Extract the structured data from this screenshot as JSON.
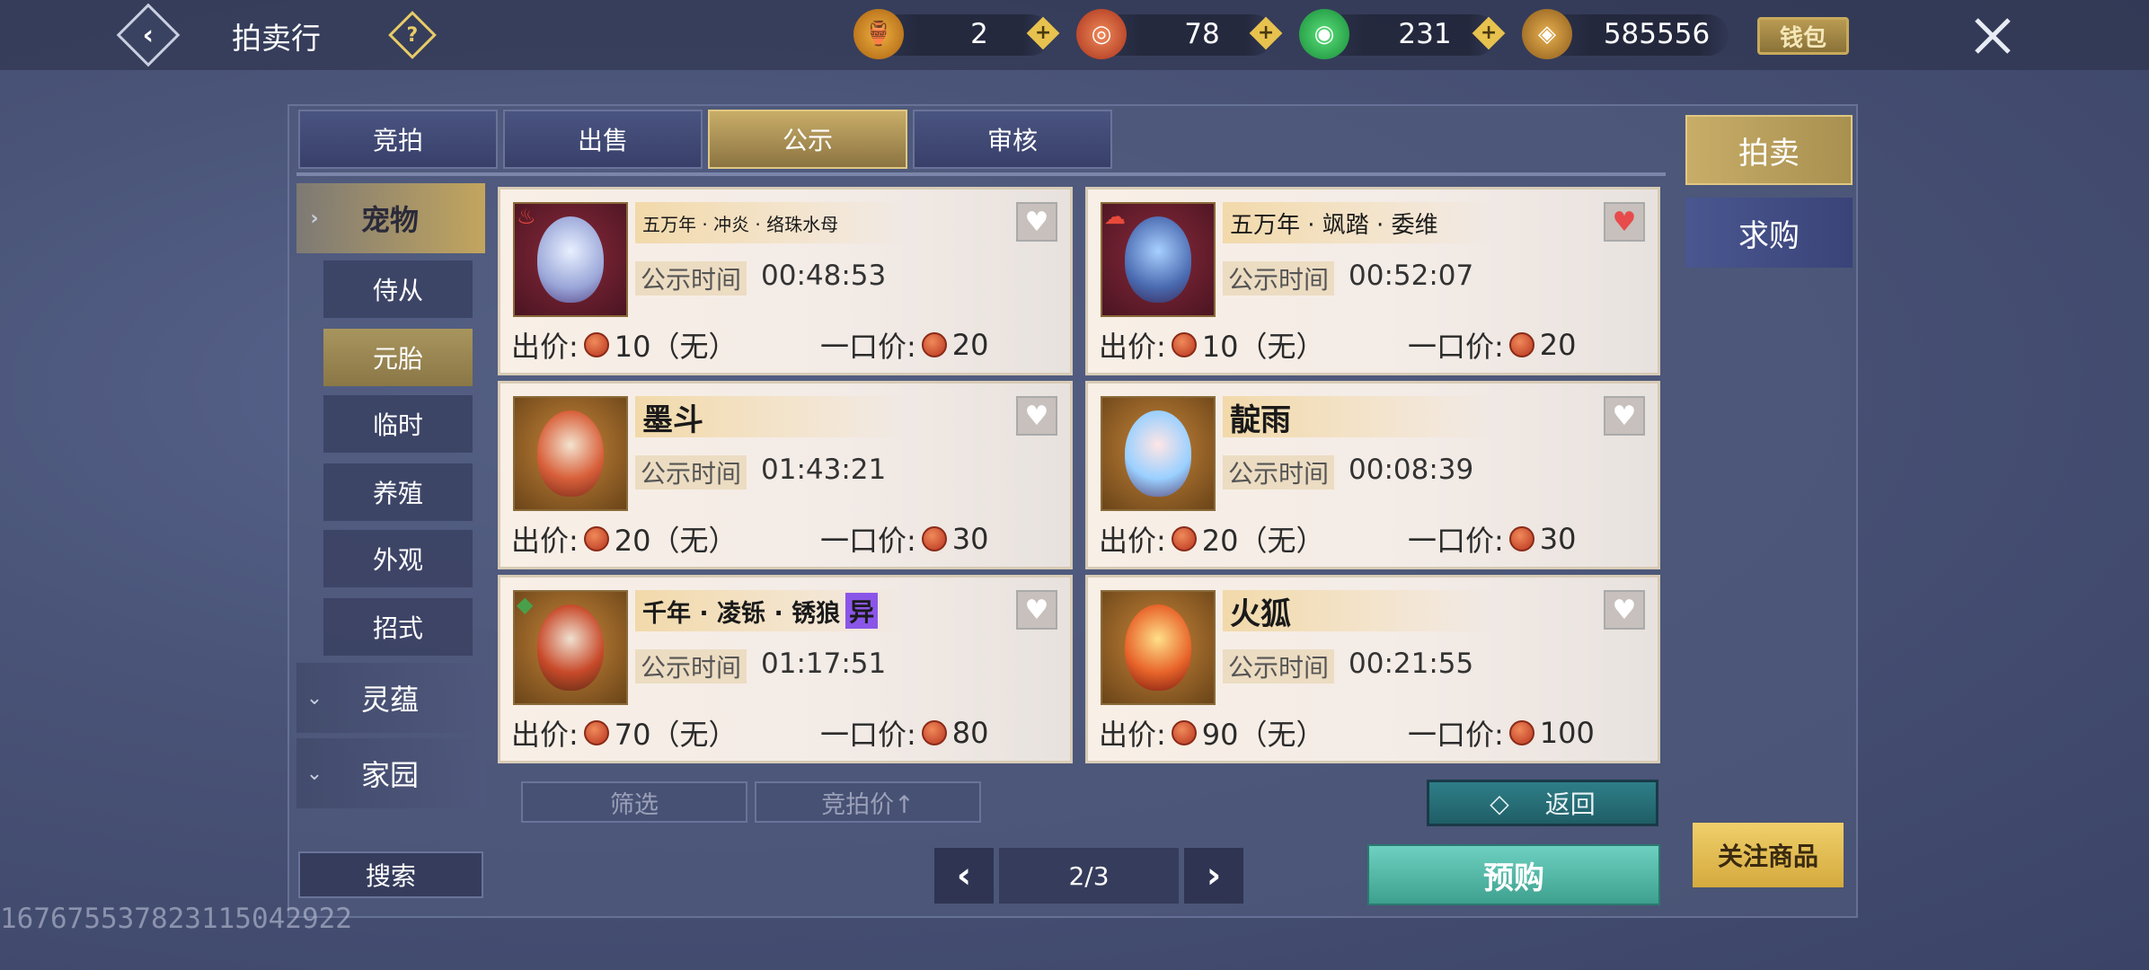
{
  "header": {
    "title": "拍卖行",
    "help_icon": "question-icon",
    "currencies": [
      {
        "name": "gold-gourd-icon",
        "value": "2"
      },
      {
        "name": "red-swirl-coin-icon",
        "value": "78"
      },
      {
        "name": "green-jade-icon",
        "value": "231"
      },
      {
        "name": "copper-coin-icon",
        "value": "585556"
      }
    ],
    "wallet_label": "钱包"
  },
  "tabs": [
    {
      "label": "竞拍",
      "active": false
    },
    {
      "label": "出售",
      "active": false
    },
    {
      "label": "公示",
      "active": true
    },
    {
      "label": "审核",
      "active": false
    }
  ],
  "sidebar": {
    "categories": [
      {
        "label": "宠物",
        "expanded": true
      },
      {
        "label": "灵蕴",
        "expanded": false
      },
      {
        "label": "家园",
        "expanded": false
      }
    ],
    "subitems": [
      {
        "label": "侍从"
      },
      {
        "label": "元胎",
        "active": true
      },
      {
        "label": "临时"
      },
      {
        "label": "养殖"
      },
      {
        "label": "外观"
      },
      {
        "label": "招式"
      }
    ]
  },
  "listings": [
    {
      "name": "五万年 · 冲炎 · 络珠水母",
      "time_label": "公示时间",
      "time": "00:48:53",
      "bid_label": "出价:",
      "bid": "10（无）",
      "buyout_label": "一口价:",
      "buyout": "20",
      "favorited": false
    },
    {
      "name": "五万年 · 飒踏 · 委维",
      "time_label": "公示时间",
      "time": "00:52:07",
      "bid_label": "出价:",
      "bid": "10（无）",
      "buyout_label": "一口价:",
      "buyout": "20",
      "favorited": true
    },
    {
      "name": "墨斗",
      "time_label": "公示时间",
      "time": "01:43:21",
      "bid_label": "出价:",
      "bid": "20（无）",
      "buyout_label": "一口价:",
      "buyout": "30",
      "favorited": false
    },
    {
      "name": "靛雨",
      "time_label": "公示时间",
      "time": "00:08:39",
      "bid_label": "出价:",
      "bid": "20（无）",
      "buyout_label": "一口价:",
      "buyout": "30",
      "favorited": false
    },
    {
      "name": "千年 · 凌铄 · 锈狼",
      "tag": "异",
      "time_label": "公示时间",
      "time": "01:17:51",
      "bid_label": "出价:",
      "bid": "70（无）",
      "buyout_label": "一口价:",
      "buyout": "80",
      "favorited": false
    },
    {
      "name": "火狐",
      "time_label": "公示时间",
      "time": "00:21:55",
      "bid_label": "出价:",
      "bid": "90（无）",
      "buyout_label": "一口价:",
      "buyout": "100",
      "favorited": false
    }
  ],
  "controls": {
    "filter_label": "筛选",
    "sort_label": "竞拍价↑",
    "return_label": "返回",
    "search_label": "搜索",
    "page": "2/3",
    "preorder_label": "预购"
  },
  "right_tabs": [
    {
      "label": "拍卖",
      "active": true
    },
    {
      "label": "求购",
      "active": false
    }
  ],
  "follow_label": "关注商品",
  "watermark": "1676755378231150429​22"
}
